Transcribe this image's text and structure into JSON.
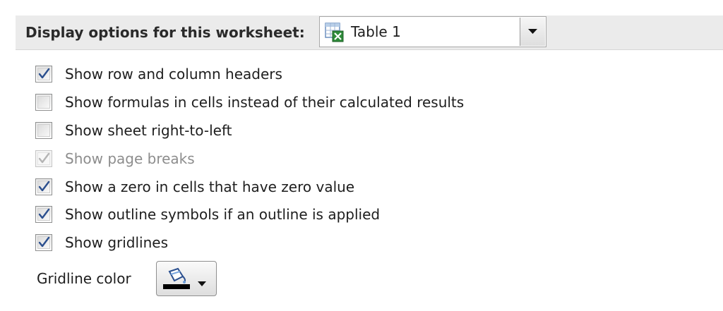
{
  "header": {
    "label": "Display options for this worksheet:",
    "sheet_select": {
      "value": "Table 1",
      "icon": "worksheet-icon"
    }
  },
  "options": [
    {
      "label": "Show row and column headers",
      "checked": true,
      "disabled": false
    },
    {
      "label": "Show formulas in cells instead of their calculated results",
      "checked": false,
      "disabled": false
    },
    {
      "label": "Show sheet right-to-left",
      "checked": false,
      "disabled": false
    },
    {
      "label": "Show page breaks",
      "checked": true,
      "disabled": true
    },
    {
      "label": "Show a zero in cells that have zero value",
      "checked": true,
      "disabled": false
    },
    {
      "label": "Show outline symbols if an outline is applied",
      "checked": true,
      "disabled": false
    },
    {
      "label": "Show gridlines",
      "checked": true,
      "disabled": false
    }
  ],
  "gridline_color": {
    "label": "Gridline color",
    "icon": "paint-bucket-icon",
    "swatch_color": "#000000"
  },
  "colors": {
    "header_bg": "#ebebeb",
    "check_blue": "#2b4f8e",
    "disabled_text": "#8d8d8d"
  }
}
